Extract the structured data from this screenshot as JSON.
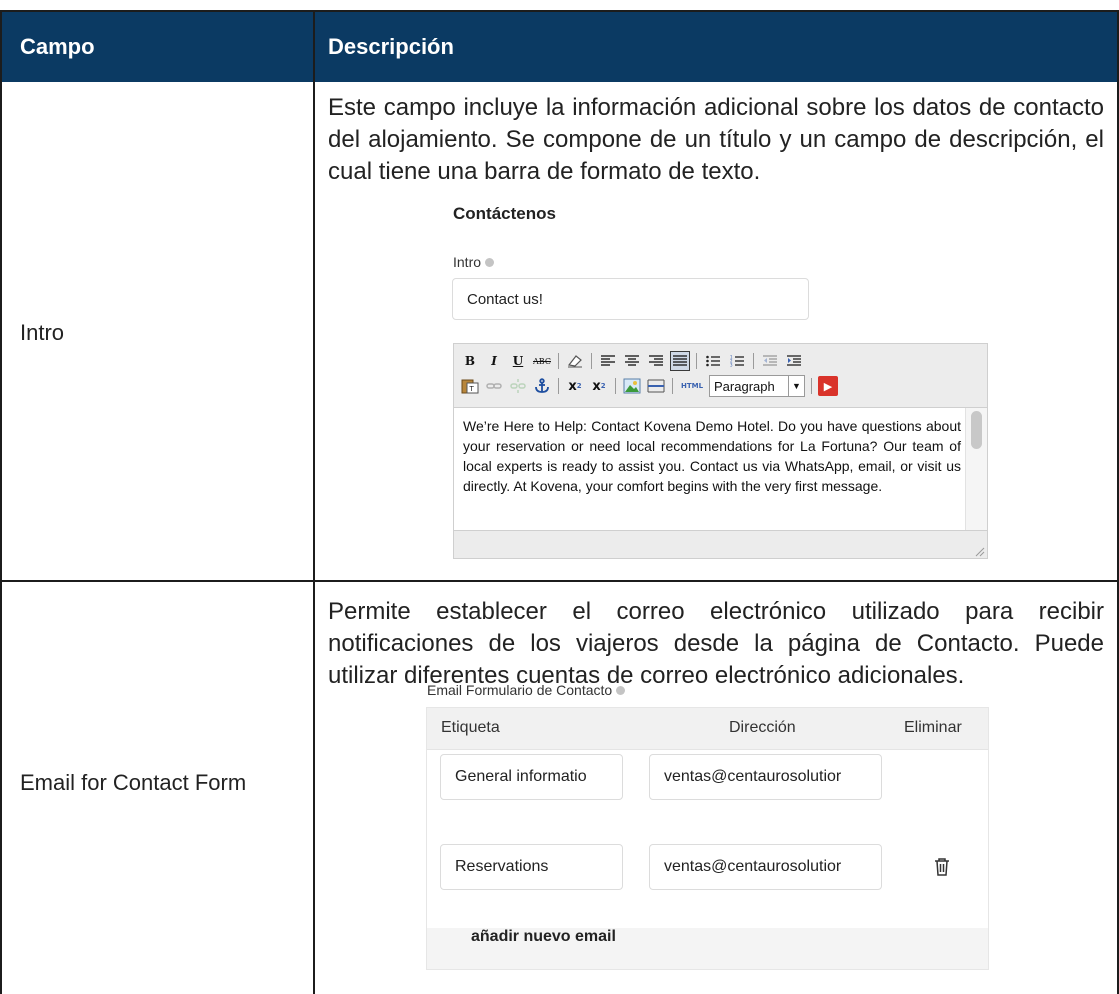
{
  "table": {
    "headers": {
      "field": "Campo",
      "description": "Descripción"
    },
    "rows": [
      {
        "field": "Intro",
        "description": "Este campo incluye la información adicional sobre los datos de contacto del alojamiento. Se compone de un título y un campo de descripción, el cual tiene una barra de formato de texto."
      },
      {
        "field": "Email for Contact Form",
        "description": "Permite establecer el correo electrónico utilizado para recibir notificaciones de los viajeros desde la página de Contacto. Puede utilizar diferentes cuentas de correo electrónico adicionales."
      }
    ]
  },
  "intro_screenshot": {
    "section_title": "Contáctenos",
    "intro_label": "Intro",
    "intro_value": "Contact us!",
    "format_select": "Paragraph",
    "editor_text": "We’re Here to Help: Contact Kovena Demo Hotel. Do you have questions about your reservation or need local recommendations for La Fortuna? Our team of local experts is ready to assist you. Contact us via WhatsApp, email, or visit us directly. At Kovena, your comfort begins with the very first message."
  },
  "email_screenshot": {
    "label": "Email Formulario de Contacto",
    "columns": {
      "label": "Etiqueta",
      "address": "Dirección",
      "delete": "Eliminar"
    },
    "rows": [
      {
        "label": "General informatio",
        "address": "ventas@centaurosolutior"
      },
      {
        "label": "Reservations",
        "address": "ventas@centaurosolutior"
      }
    ],
    "add_button": "añadir nuevo email"
  },
  "colors": {
    "header_bg": "#0b3a63",
    "header_text": "#ffffff",
    "trash_icon": "#333333"
  }
}
